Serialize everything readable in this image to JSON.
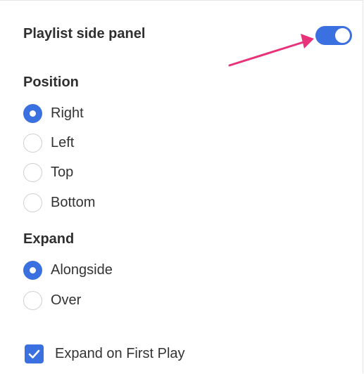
{
  "panel": {
    "title": "Playlist side panel",
    "toggle_state": "on"
  },
  "position": {
    "label": "Position",
    "options": [
      {
        "label": "Right",
        "selected": true
      },
      {
        "label": "Left",
        "selected": false
      },
      {
        "label": "Top",
        "selected": false
      },
      {
        "label": "Bottom",
        "selected": false
      }
    ]
  },
  "expand": {
    "label": "Expand",
    "options": [
      {
        "label": "Alongside",
        "selected": true
      },
      {
        "label": "Over",
        "selected": false
      }
    ]
  },
  "expand_on_first_play": {
    "label": "Expand on First Play",
    "checked": true
  },
  "colors": {
    "accent": "#3b70e0",
    "annotation_arrow": "#e8327a",
    "text": "#2f2f2f"
  },
  "icons": {
    "toggle": "toggle-switch-icon",
    "checkmark": "checkmark-icon",
    "arrow": "annotation-arrow-icon"
  }
}
